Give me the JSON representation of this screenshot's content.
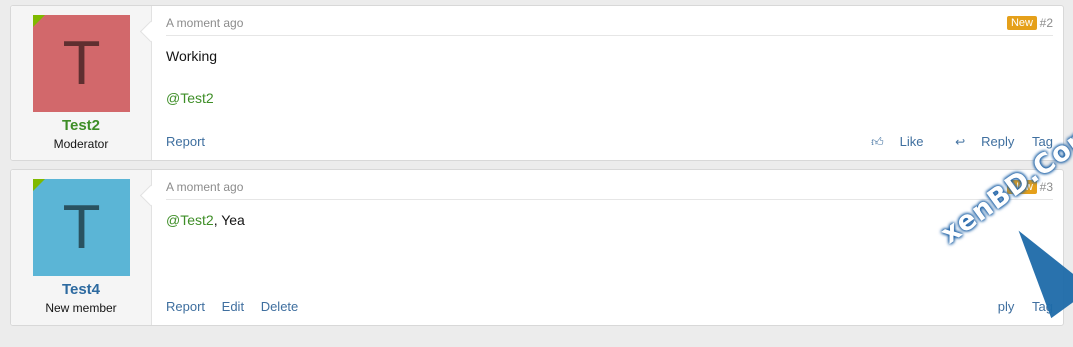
{
  "posts": [
    {
      "avatar_letter": "T",
      "avatar_color": "#d2686b",
      "username": "Test2",
      "username_color": "#3e8e27",
      "user_title": "Moderator",
      "timestamp": "A moment ago",
      "new_badge": "New",
      "post_number": "#2",
      "content_line1": "Working",
      "content_mention": "@Test2",
      "footer_left": [
        "Report"
      ],
      "like_label": "Like",
      "reply_label": "Reply",
      "tag_label": "Tag"
    },
    {
      "avatar_letter": "T",
      "avatar_color": "#5bb5d6",
      "username": "Test4",
      "username_color": "#2d6aa0",
      "user_title": "New member",
      "timestamp": "A moment ago",
      "new_badge": "New",
      "post_number": "#3",
      "content_mention": "@Test2",
      "content_rest": ", Yea",
      "footer_left": [
        "Report",
        "Edit",
        "Delete"
      ],
      "reply_label": "ply",
      "tag_label": "Tag"
    }
  ],
  "watermark": {
    "text": "xenBD.Com"
  },
  "colors": {
    "accent": "#3e8e27",
    "link": "#3f6f9f",
    "badge": "#e5a01a"
  }
}
